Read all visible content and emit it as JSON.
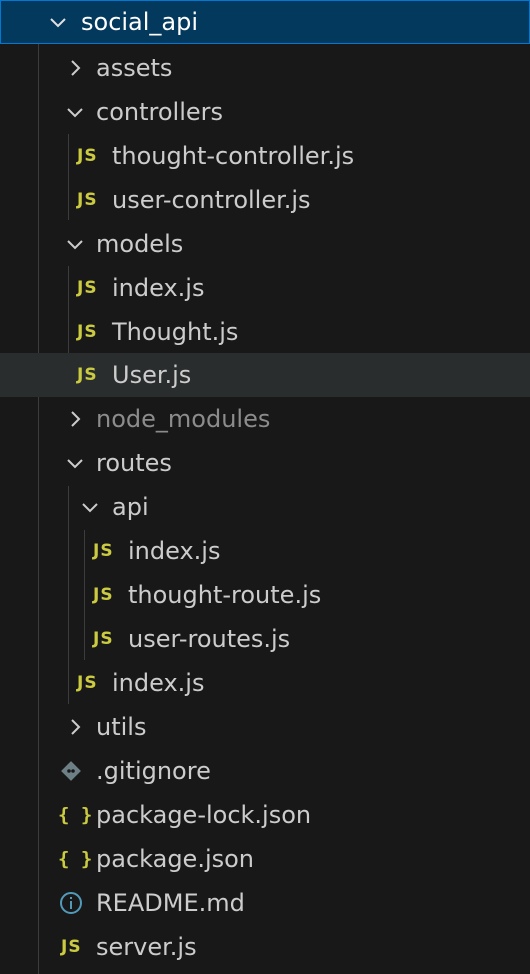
{
  "root": {
    "label": "social_api",
    "expanded": true
  },
  "items": {
    "assets": "assets",
    "controllers": "controllers",
    "thought_controller": "thought-controller.js",
    "user_controller": "user-controller.js",
    "models": "models",
    "models_index": "index.js",
    "thought_model": "Thought.js",
    "user_model": "User.js",
    "node_modules": "node_modules",
    "routes": "routes",
    "api": "api",
    "api_index": "index.js",
    "thought_route": "thought-route.js",
    "user_routes": "user-routes.js",
    "routes_index": "index.js",
    "utils": "utils",
    "gitignore": ".gitignore",
    "package_lock": "package-lock.json",
    "package_json": "package.json",
    "readme": "README.md",
    "server": "server.js"
  },
  "icons": {
    "js_badge": "JS",
    "json_badge": "{ }"
  },
  "colors": {
    "selection": "#04395e",
    "selection_border": "#0078d4",
    "hover": "#2a2d2e",
    "js_yellow": "#cbcb41",
    "info_blue": "#519aba",
    "git_gray": "#6d8086",
    "ignored_text": "#8c8c8c"
  }
}
